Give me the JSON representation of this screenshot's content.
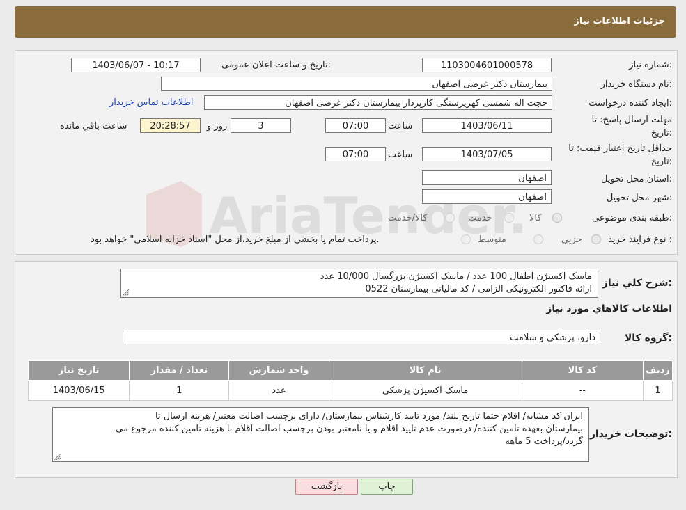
{
  "header": {
    "title": "جزئیات اطلاعات نیاز"
  },
  "info": {
    "need_number_label": "شماره نیاز:",
    "need_number": "1103004601000578",
    "announce_label": "تاریخ و ساعت اعلان عمومی:",
    "announce_value": "1403/06/07 - 10:17",
    "buyer_org_label": "نام دستگاه خریدار:",
    "buyer_org": "بیمارستان دکتر غرضی اصفهان",
    "requester_label": "ایجاد کننده درخواست:",
    "requester": "حجت اله شمسی کهریزسنگی کارپرداز بیمارستان دکتر غرضی اصفهان",
    "contact_link": "اطلاعات تماس خریدار",
    "deadline_label_1": "مهلت ارسال پاسخ: تا",
    "deadline_label_2": "تاریخ:",
    "deadline_date": "1403/06/11",
    "time_label": "ساعت",
    "deadline_time": "07:00",
    "days_value": "3",
    "days_label": "روز و",
    "remaining_time": "20:28:57",
    "remaining_label": "ساعت باقي مانده",
    "validity_label_1": "حداقل تاریخ اعتبار قیمت: تا",
    "validity_label_2": "تاریخ:",
    "validity_date": "1403/07/05",
    "validity_time": "07:00",
    "province_label": "استان محل تحویل:",
    "province": "اصفهان",
    "city_label": "شهر محل تحویل:",
    "city": "اصفهان",
    "category_label": "طبقه بندی موضوعی:",
    "category_options": [
      "کالا",
      "خدمت",
      "کالا/خدمت"
    ],
    "process_label": "نوع فرآیند خرید :",
    "process_options": [
      "جزیي",
      "متوسط"
    ],
    "process_note": "پرداخت تمام یا بخشی از مبلغ خرید،از محل \"اسناد خزانه اسلامی\" خواهد بود."
  },
  "summary": {
    "label": "شرح كلي نياز:",
    "line1": "ماسک اکسیژن اطفال 100 عدد / ماسک اکسیژن بزرگسال 10/000 عدد",
    "line2": "ارائه فاکتور الکترونیکی الزامی / کد مالیاتی بیمارستان 0522",
    "goods_info_title": "اطلاعات كالاهاي مورد نياز",
    "group_label": "گروه کالا:",
    "group_value": "دارو، پزشکی و سلامت"
  },
  "table": {
    "headers": [
      "ردیف",
      "کد کالا",
      "نام کالا",
      "واحد شمارش",
      "تعداد / مقدار",
      "تاریخ نیاز"
    ],
    "rows": [
      [
        "1",
        "--",
        "ماسک اکسیژن پزشکی",
        "عدد",
        "1",
        "1403/06/15"
      ]
    ]
  },
  "buyer_notes": {
    "label": "توضیحات خریدار:",
    "line1": "ایران کد مشابه/ اقلام حتما تاریخ بلند/ مورد تایید کارشناس بیمارستان/ دارای برچسب اصالت معتبر/ هزینه ارسال تا",
    "line2": "بیمارستان بعهده تامین کننده/ درصورت عدم تایید اقلام و یا نامعتبر بودن برچسب اصالت اقلام با هزینه تامین کننده مرجوع می",
    "line3": "گردد/پرداخت 5 ماهه"
  },
  "buttons": {
    "print": "چاپ",
    "back": "بازگشت"
  },
  "watermark": "AriaTender.neT",
  "colors": {
    "header_bg": "#8a6b3c",
    "link": "#1a3fb5",
    "table_header": "#9a9a9a"
  }
}
